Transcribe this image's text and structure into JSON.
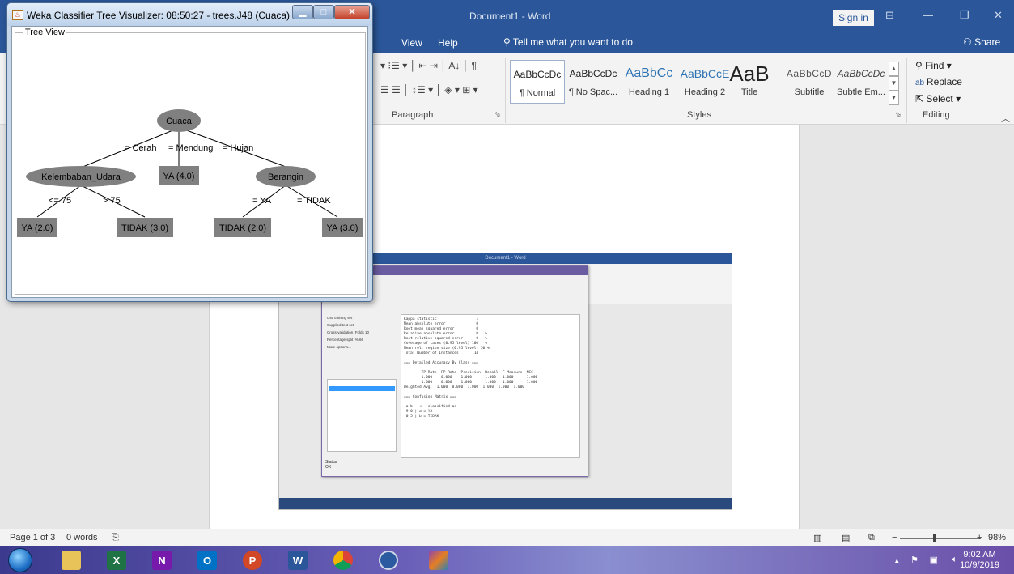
{
  "word": {
    "title": "Document1 - Word",
    "signin": "Sign in",
    "menu": {
      "view": "View",
      "help": "Help",
      "tellme": "Tell me what you want to do",
      "share": "Share"
    },
    "paragraph_label": "Paragraph",
    "styles_label": "Styles",
    "editing_label": "Editing",
    "styles": [
      {
        "sample": "AaBbCcDc",
        "name": "¶ Normal"
      },
      {
        "sample": "AaBbCcDc",
        "name": "¶ No Spac..."
      },
      {
        "sample": "AaBbCc",
        "name": "Heading 1"
      },
      {
        "sample": "AaBbCcE",
        "name": "Heading 2"
      },
      {
        "sample": "AaB",
        "name": "Title"
      },
      {
        "sample": "AaBbCcD",
        "name": "Subtitle"
      },
      {
        "sample": "AaBbCcDc",
        "name": "Subtle Em..."
      }
    ],
    "editing": {
      "find": "Find",
      "replace": "Replace",
      "select": "Select"
    },
    "status": {
      "page": "Page 1 of 3",
      "words": "0 words",
      "zoom": "98%"
    }
  },
  "taskbar": {
    "clock_time": "9:02 AM",
    "clock_date": "10/9/2019",
    "apps": [
      {
        "name": "explorer",
        "letter": "",
        "color": "#e8c35a"
      },
      {
        "name": "excel",
        "letter": "X",
        "color": "#1f7244"
      },
      {
        "name": "onenote",
        "letter": "N",
        "color": "#7719aa"
      },
      {
        "name": "outlook",
        "letter": "O",
        "color": "#0072c6"
      },
      {
        "name": "powerpoint",
        "letter": "P",
        "color": "#d24726"
      },
      {
        "name": "word",
        "letter": "W",
        "color": "#2b579a"
      },
      {
        "name": "chrome",
        "letter": "",
        "color": "#db4437"
      },
      {
        "name": "weka",
        "letter": "",
        "color": "#2c5aa0"
      },
      {
        "name": "winrar",
        "letter": "",
        "color": "#8e44ad"
      }
    ]
  },
  "weka": {
    "title": "Weka Classifier Tree Visualizer: 08:50:27 - trees.J48 (Cuaca)",
    "tree_view_label": "Tree View",
    "tree": {
      "root": "Cuaca",
      "edges": {
        "cerah": "= Cerah",
        "mendung": "= Mendung",
        "hujan": "= Hujan",
        "le75": "<= 75",
        "gt75": "> 75",
        "ya": "= YA",
        "tidak": "= TIDAK"
      },
      "nodes": {
        "kelembaban": "Kelembaban_Udara",
        "berangin": "Berangin"
      },
      "leaves": {
        "mendung": "YA (4.0)",
        "le75": "YA (2.0)",
        "gt75": "TIDAK (3.0)",
        "ya": "TIDAK (2.0)",
        "tidak": "YA (3.0)"
      }
    }
  },
  "embedded": {
    "word_title": "Document1 - Word",
    "output_text": "Kappa statistic                  1\nMean absolute error              0\nRoot mean squared error          0\nRelative absolute error          0   %\nRoot relative squared error      0   %\nCoverage of cases (0.95 level) 100   %\nMean rel. region size (0.95 level) 50 %\nTotal Number of Instances       14\n\n=== Detailed Accuracy By Class ===\n\n        TP Rate  FP Rate  Precision  Recall  F-Measure  MCC\n        1.000    0.000    1.000      1.000   1.000      1.000\n        1.000    0.000    1.000      1.000   1.000      1.000\nWeighted Avg.  1.000  0.000  1.000  1.000  1.000  1.000\n\n=== Confusion Matrix ===\n\n a b   <-- classified as\n 9 0 | a = YA\n 0 5 | b = TIDAK",
    "left_options": "Use training set\nSupplied test set\nCross-validation  Folds 10\nPercentage split  % 66\nMore options...",
    "status": "Status\nOK"
  }
}
